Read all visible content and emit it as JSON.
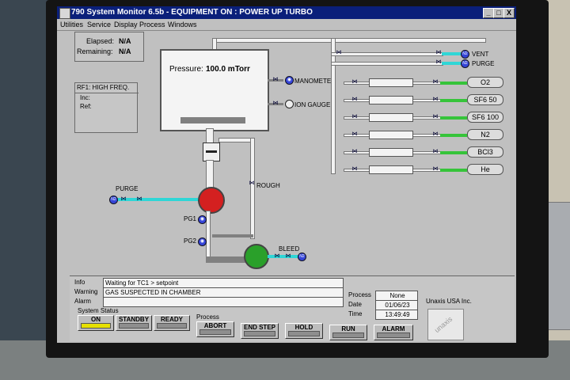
{
  "app": {
    "title": "790 System Monitor 6.5b - EQUIPMENT ON : POWER UP TURBO",
    "window_buttons": [
      "_",
      "□",
      "X"
    ]
  },
  "menu": [
    "Utilities",
    "Service",
    "Display",
    "Process",
    "Windows"
  ],
  "timers": {
    "elapsed_label": "Elapsed:",
    "elapsed_value": "N/A",
    "remaining_label": "Remaining:",
    "remaining_value": "N/A"
  },
  "rf": {
    "title": "RF1: HIGH FREQ.",
    "inc_label": "Inc:",
    "ref_label": "Ref:"
  },
  "chamber": {
    "pressure_label": "Pressure:",
    "pressure_value": "100.0 mTorr"
  },
  "labels": {
    "manometer": "MANOMETER",
    "ion_gauge": "ION GAUGE",
    "purge_left": "PURGE",
    "rough": "ROUGH",
    "pg1": "PG1",
    "pg2": "PG2",
    "bleed": "BLEED",
    "vent": "VENT",
    "purge_right": "PURGE",
    "n2_tag": "N2"
  },
  "gases": [
    "O2",
    "SF6 50",
    "SF6 100",
    "N2",
    "BCl3",
    "He"
  ],
  "status": {
    "info_label": "Info",
    "info_value": "Waiting for TC1 > setpoint",
    "warning_label": "Warning",
    "warning_value": "GAS SUSPECTED IN CHAMBER",
    "alarm_label": "Alarm",
    "alarm_value": "",
    "process_label": "Process",
    "process_value": "None",
    "date_label": "Date",
    "date_value": "01/06/23",
    "time_label": "Time",
    "time_value": "13:49:49",
    "company": "Unaxis USA Inc.",
    "logo_text": "unaxis"
  },
  "system_status": {
    "title": "System Status",
    "buttons": [
      "ON",
      "STANDBY",
      "READY"
    ]
  },
  "process_group": {
    "title": "Process",
    "buttons": [
      "ABORT",
      "END STEP",
      "HOLD",
      "RUN",
      "ALARM"
    ]
  },
  "colors": {
    "titlebar": "#0a1f7a",
    "turbo_pump": "#d42020",
    "rough_pump": "#2aa02a",
    "n2_line": "#2fd6d6",
    "gas_line": "#36c43a",
    "on_indicator": "#e6e000"
  }
}
